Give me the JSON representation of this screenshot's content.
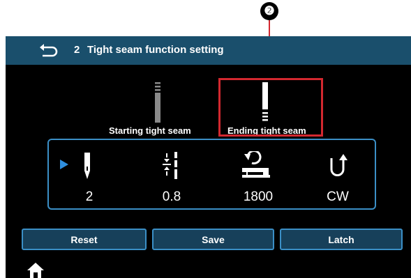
{
  "callout": {
    "number": "❷"
  },
  "titlebar": {
    "number": "2",
    "title": "Tight seam function setting",
    "back_icon": "return-arrow-icon"
  },
  "modes": [
    {
      "label": "Starting tight seam",
      "icon": "starting-seam-icon",
      "selected": false
    },
    {
      "label": "Ending tight seam",
      "icon": "ending-seam-icon",
      "selected": true
    }
  ],
  "params": [
    {
      "icon": "needle-stitch-count-icon",
      "value": "2",
      "selected": true
    },
    {
      "icon": "stitch-pitch-icon",
      "value": "0.8"
    },
    {
      "icon": "sewing-speed-icon",
      "value": "1800"
    },
    {
      "icon": "rotation-direction-icon",
      "value": "CW"
    }
  ],
  "buttons": {
    "reset": "Reset",
    "save": "Save",
    "latch": "Latch"
  },
  "colors": {
    "titlebar": "#1a4f6c",
    "panel_border": "#3b8fc6",
    "button_fill": "#17405a",
    "highlight": "#d3282f",
    "selection_arrow": "#2f8fde"
  },
  "footer": {
    "home_icon": "home-icon"
  }
}
